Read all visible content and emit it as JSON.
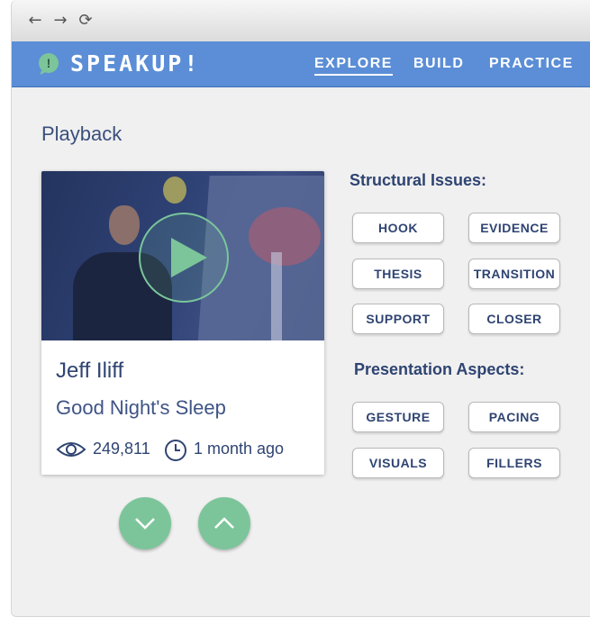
{
  "browser": {
    "back_icon": "arrow-left-icon",
    "forward_icon": "arrow-right-icon",
    "reload_icon": "reload-icon"
  },
  "app": {
    "logo_glyph": "!",
    "logo_text": "SPEAKUP!",
    "nav": [
      {
        "label": "EXPLORE",
        "active": true
      },
      {
        "label": "BUILD",
        "active": false
      },
      {
        "label": "PRACTICE",
        "active": false
      }
    ]
  },
  "page": {
    "title": "Playback"
  },
  "video_card": {
    "speaker": "Jeff Iliff",
    "talk_title": "Good Night's Sleep",
    "views": "249,811",
    "age": "1 month ago"
  },
  "structural": {
    "heading": "Structural Issues:",
    "chips": [
      "HOOK",
      "EVIDENCE",
      "THESIS",
      "TRANSITION",
      "SUPPORT",
      "CLOSER"
    ]
  },
  "presentation": {
    "heading": "Presentation Aspects:",
    "chips": [
      "GESTURE",
      "PACING",
      "VISUALS",
      "FILLERS"
    ]
  },
  "controls": {
    "down_icon": "chevron-down-icon",
    "up_icon": "chevron-up-icon"
  },
  "colors": {
    "appbar": "#5b8ed6",
    "accent": "#7cc59a",
    "text": "#2f4472",
    "background": "#f0f0f0"
  }
}
